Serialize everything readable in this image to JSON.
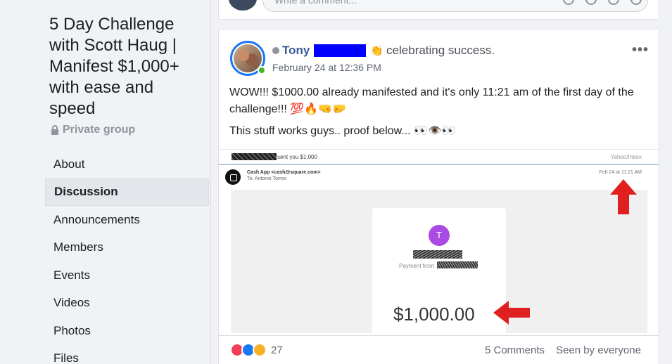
{
  "sidebar": {
    "group_title": "5 Day Challenge with Scott Haug | Manifest $1,000+ with ease and speed",
    "privacy_label": "Private group",
    "nav_items": [
      {
        "label": "About"
      },
      {
        "label": "Discussion"
      },
      {
        "label": "Announcements"
      },
      {
        "label": "Members"
      },
      {
        "label": "Events"
      },
      {
        "label": "Videos"
      },
      {
        "label": "Photos"
      },
      {
        "label": "Files"
      }
    ],
    "active_item": "Discussion"
  },
  "composer": {
    "placeholder": "Write a comment..."
  },
  "post": {
    "author": "Tony",
    "activity": "celebrating success.",
    "timestamp": "February 24 at 12:36 PM",
    "body_line_1": "WOW!!! $1000.00 already manifested and it's only 11:21 am of the first day of the challenge!!! 💯🔥🤜🤛",
    "body_line_2": "This stuff works guys.. proof below... 👀👁️👀",
    "screenshot": {
      "subject": "sent you $1,000",
      "folder": "Yahoo/Inbox",
      "from": "Cash App <cash@square.com>",
      "to": "To: Antonio Torres",
      "date": "Feb 24 at 11:21 AM",
      "avatar_letter": "T",
      "payment_from_label": "Payment from",
      "amount": "$1,000.00"
    },
    "reaction_count": "27",
    "comments_label": "5 Comments",
    "seen_label": "Seen by everyone"
  },
  "colors": {
    "link_blue": "#385898",
    "redaction_blue": "#0000ff",
    "online_green": "#42b72a",
    "arrow_red": "#e02020"
  }
}
